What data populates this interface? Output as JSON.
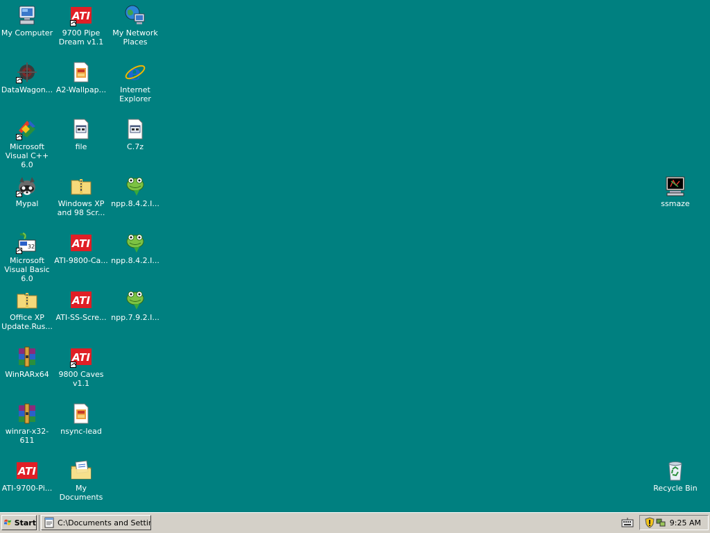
{
  "desktop": {
    "background_color": "#008080",
    "icons": [
      {
        "label": "My Computer",
        "icon": "my-computer-icon"
      },
      {
        "label": "9700 Pipe Dream v1.1",
        "icon": "ati-logo-icon",
        "shortcut": true
      },
      {
        "label": "My Network Places",
        "icon": "network-places-icon"
      },
      {
        "label": "DataWagon...",
        "icon": "datawagon-icon",
        "shortcut": true
      },
      {
        "label": "A2-Wallpap...",
        "icon": "image-file-icon"
      },
      {
        "label": "Internet Explorer",
        "icon": "internet-explorer-icon"
      },
      {
        "label": "Microsoft Visual C++ 6.0",
        "icon": "visual-cpp-icon",
        "shortcut": true
      },
      {
        "label": "file",
        "icon": "generic-file-icon"
      },
      {
        "label": "C.7z",
        "icon": "generic-file-icon"
      },
      {
        "label": "Mypal",
        "icon": "mypal-raccoon-icon",
        "shortcut": true
      },
      {
        "label": "Windows XP and 98 Scr...",
        "icon": "zip-folder-icon"
      },
      {
        "label": "npp.8.4.2.I...",
        "icon": "notepad-plus-plus-icon"
      },
      {
        "label": "Microsoft Visual Basic 6.0",
        "icon": "visual-basic-icon",
        "shortcut": true
      },
      {
        "label": "ATI-9800-Ca...",
        "icon": "ati-logo-icon"
      },
      {
        "label": "npp.8.4.2.I...",
        "icon": "notepad-plus-plus-icon"
      },
      {
        "label": "Office XP Update.Rus...",
        "icon": "zip-folder-icon"
      },
      {
        "label": "ATI-SS-Scre...",
        "icon": "ati-logo-icon"
      },
      {
        "label": "npp.7.9.2.I...",
        "icon": "notepad-plus-plus-icon"
      },
      {
        "label": "WinRARx64",
        "icon": "winrar-icon"
      },
      {
        "label": "9800 Caves v1.1",
        "icon": "ati-logo-icon",
        "shortcut": true
      },
      {
        "label": "winrar-x32-611",
        "icon": "winrar-icon"
      },
      {
        "label": "nsync-lead",
        "icon": "image-file-icon"
      },
      {
        "label": "ATI-9700-Pi...",
        "icon": "ati-logo-icon"
      },
      {
        "label": "My Documents",
        "icon": "my-documents-icon"
      },
      {
        "label": "ssmaze",
        "icon": "screensaver-icon"
      },
      {
        "label": "Recycle Bin",
        "icon": "recycle-bin-icon"
      }
    ]
  },
  "taskbar": {
    "start_label": "Start",
    "task_label": "C:\\Documents and Settin...",
    "clock": "9:25 AM"
  }
}
